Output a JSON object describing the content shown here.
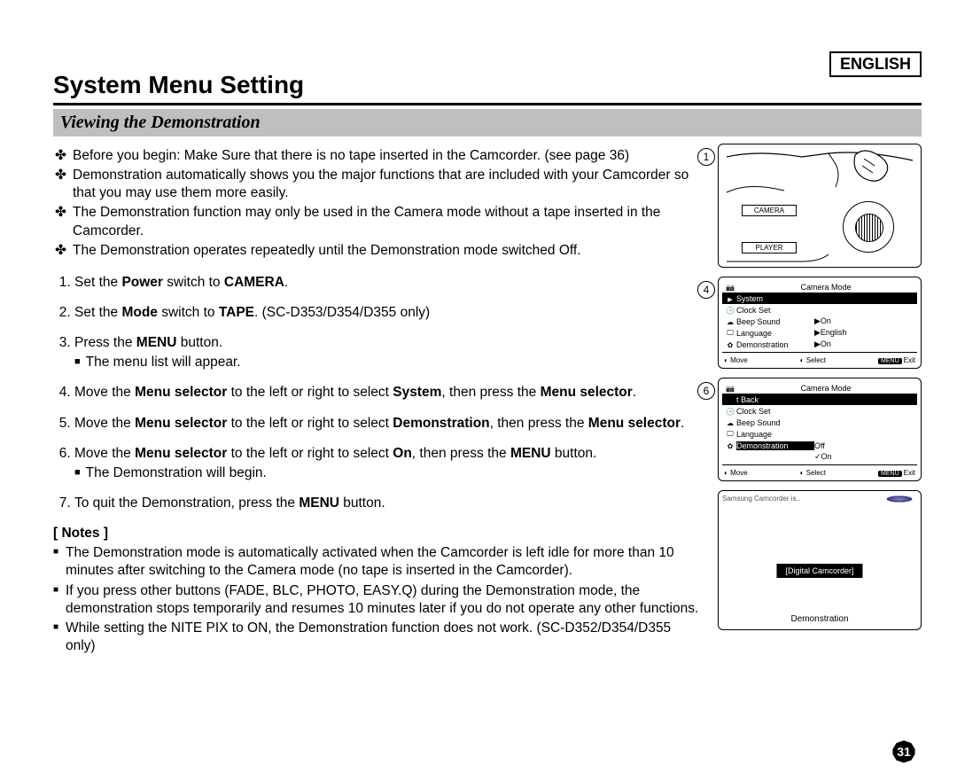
{
  "language_label": "ENGLISH",
  "page_title": "System Menu Setting",
  "section_heading": "Viewing the Demonstration",
  "intro_bullets": [
    "Before you begin: Make Sure that there is no tape inserted in the Camcorder. (see page 36)",
    "Demonstration automatically shows you the major functions that are included with your Camcorder so that you may use them more easily.",
    "The Demonstration function may only be used in the Camera mode without a tape inserted in the Camcorder.",
    "The Demonstration operates repeatedly until the Demonstration mode switched Off."
  ],
  "steps": {
    "s1_a": "Set the ",
    "s1_b1": "Power",
    "s1_c": " switch to ",
    "s1_b2": "CAMERA",
    "s1_d": ".",
    "s2_a": "Set the ",
    "s2_b1": "Mode",
    "s2_c": " switch to ",
    "s2_b2": "TAPE",
    "s2_d": ". (SC-D353/D354/D355 only)",
    "s3_a": "Press the ",
    "s3_b": "MENU",
    "s3_c": " button.",
    "s3_sub": "The menu list will appear.",
    "s4_a": "Move the ",
    "s4_b1": "Menu selector",
    "s4_c": " to the left or right to select ",
    "s4_b2": "System",
    "s4_d": ", then press the ",
    "s4_b3": "Menu selector",
    "s4_e": ".",
    "s5_a": "Move the ",
    "s5_b1": "Menu selector",
    "s5_c": " to the left or right to select ",
    "s5_b2": "Demonstration",
    "s5_d": ", then press the ",
    "s5_b3": "Menu selector",
    "s5_e": ".",
    "s6_a": "Move the ",
    "s6_b1": "Menu selector",
    "s6_c": " to the left or right to select ",
    "s6_b2": "On",
    "s6_d": ", then press the ",
    "s6_b3": "MENU",
    "s6_e": " button.",
    "s6_sub": "The Demonstration will begin.",
    "s7_a": "To quit the Demonstration, press the ",
    "s7_b": "MENU",
    "s7_c": " button."
  },
  "notes_header": "[ Notes ]",
  "notes": [
    "The Demonstration mode is automatically activated when the Camcorder is left idle for more than 10 minutes after switching to the Camera mode (no tape is inserted in the Camcorder).",
    "If you press other buttons (FADE, BLC, PHOTO, EASY.Q) during the Demonstration mode, the demonstration stops temporarily and resumes 10 minutes later if you do not operate any other functions.",
    "While setting the NITE PIX to ON, the Demonstration function does not work. (SC-D352/D354/D355 only)"
  ],
  "illus": {
    "badge1": "1",
    "badge4": "4",
    "badge6": "6",
    "dial": {
      "camera": "CAMERA",
      "player": "PLAYER"
    },
    "panel4": {
      "title": "Camera Mode",
      "rows": [
        {
          "icon": "arrow",
          "label": "System",
          "val": "",
          "inv": true
        },
        {
          "icon": "sys",
          "label": "Clock Set",
          "val": ""
        },
        {
          "icon": "cloud",
          "label": "Beep Sound",
          "val": "▶On"
        },
        {
          "icon": "tv",
          "label": "Language",
          "val": "▶English"
        },
        {
          "icon": "gear",
          "label": "Demonstration",
          "val": "▶On"
        }
      ],
      "footer": {
        "move": "Move",
        "select": "Select",
        "exit": "Exit",
        "menu": "MENU"
      }
    },
    "panel6": {
      "title": "Camera Mode",
      "rows": [
        {
          "icon": "",
          "label": "   Back",
          "val": "",
          "inv": true,
          "prefix": "t"
        },
        {
          "icon": "sys",
          "label": "Clock Set",
          "val": ""
        },
        {
          "icon": "cloud",
          "label": "Beep Sound",
          "val": ""
        },
        {
          "icon": "tv",
          "label": "Language",
          "val": ""
        },
        {
          "icon": "gear",
          "label": "Demonstration",
          "val": "Off",
          "inv_label": true
        },
        {
          "icon": "",
          "label": "",
          "val": "✓On"
        }
      ],
      "footer": {
        "move": "Move",
        "select": "Select",
        "exit": "Exit",
        "menu": "MENU"
      }
    },
    "demo_panel": {
      "top_text": "Samsung Camcorder is..",
      "capsule": "[Digital Camcorder]",
      "bottom": "Demonstration"
    }
  },
  "page_number": "31"
}
